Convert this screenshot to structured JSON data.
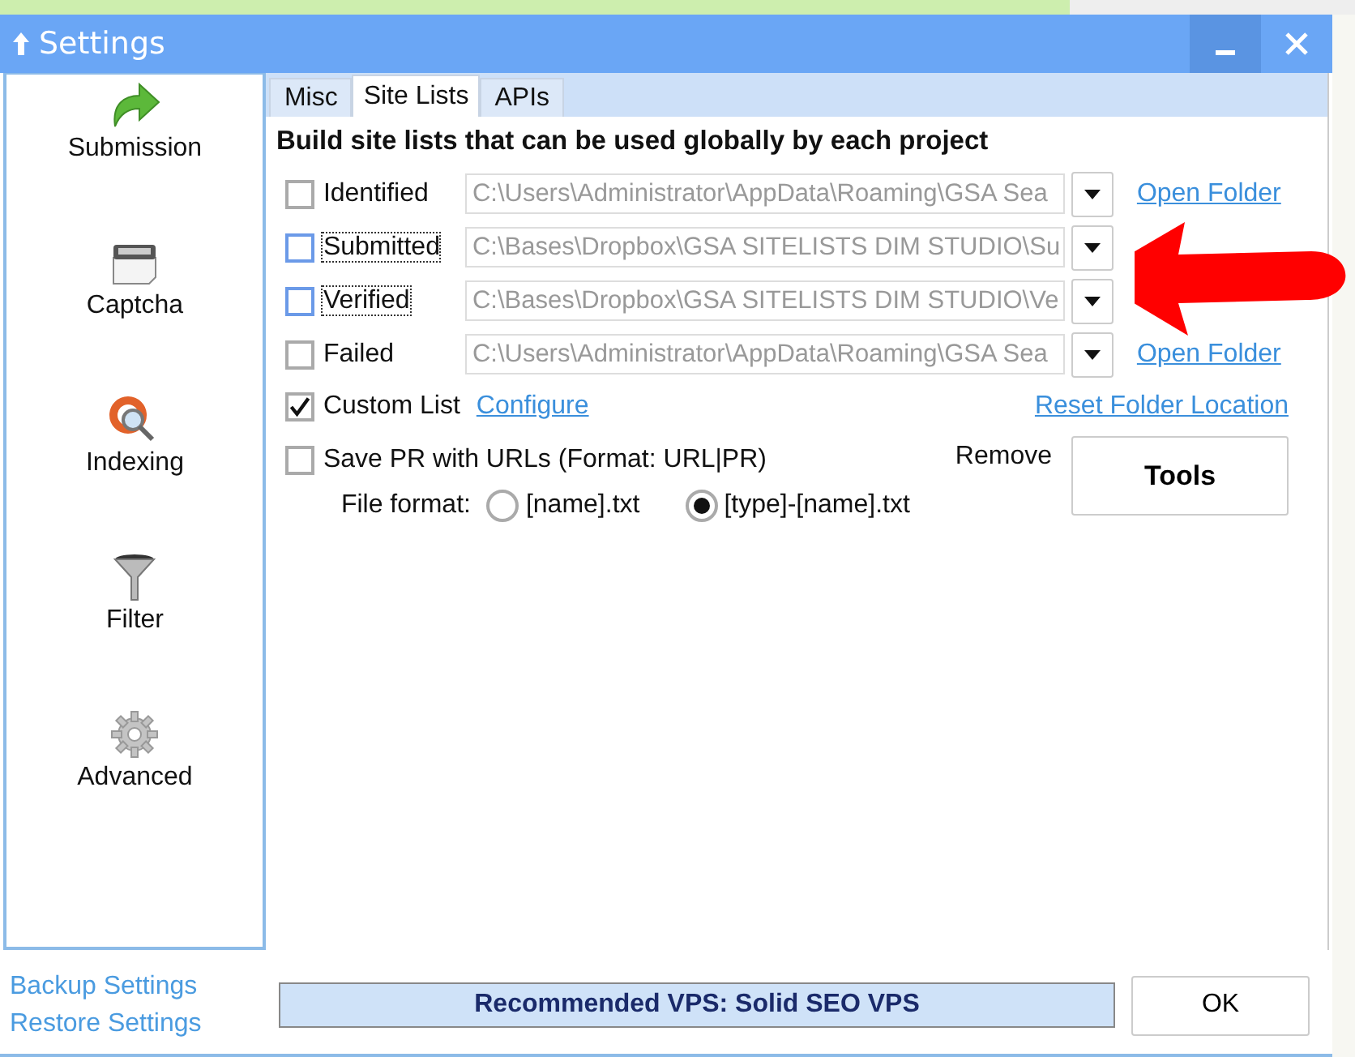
{
  "window": {
    "title": "Settings"
  },
  "sidebar": {
    "items": [
      {
        "label": "Submission"
      },
      {
        "label": "Captcha"
      },
      {
        "label": "Indexing"
      },
      {
        "label": "Filter"
      },
      {
        "label": "Advanced"
      }
    ]
  },
  "tabs": [
    {
      "label": "Misc",
      "selected": false
    },
    {
      "label": "Site Lists",
      "selected": true
    },
    {
      "label": "APIs",
      "selected": false
    }
  ],
  "heading": "Build site lists that can be used globally by each project",
  "site_lists": [
    {
      "label": "Identified",
      "checked": false,
      "highlighted": false,
      "path": "C:\\Users\\Administrator\\AppData\\Roaming\\GSA Sea",
      "link": "Open Folder"
    },
    {
      "label": "Submitted",
      "checked": false,
      "highlighted": true,
      "path": "C:\\Bases\\Dropbox\\GSA SITELISTS DIM STUDIO\\Su"
    },
    {
      "label": "Verified",
      "checked": false,
      "highlighted": true,
      "path": "C:\\Bases\\Dropbox\\GSA SITELISTS DIM STUDIO\\Ve"
    },
    {
      "label": "Failed",
      "checked": false,
      "highlighted": false,
      "path": "C:\\Users\\Administrator\\AppData\\Roaming\\GSA Sea",
      "link": "Open Folder"
    }
  ],
  "custom_list": {
    "label": "Custom List",
    "checked": true,
    "link": "Configure"
  },
  "reset_link": "Reset Folder Location",
  "save_pr": {
    "label": "Save PR with URLs (Format: URL|PR)",
    "checked": false
  },
  "file_format": {
    "label": "File format:",
    "options": [
      {
        "label": "[name].txt",
        "selected": false
      },
      {
        "label": "[type]-[name].txt",
        "selected": true
      }
    ]
  },
  "remove_label": "Remove",
  "tools_button": "Tools",
  "footer": {
    "links": [
      "Backup Settings",
      "Restore Settings"
    ],
    "banner": "Recommended VPS: Solid SEO VPS",
    "ok_button": "OK"
  }
}
